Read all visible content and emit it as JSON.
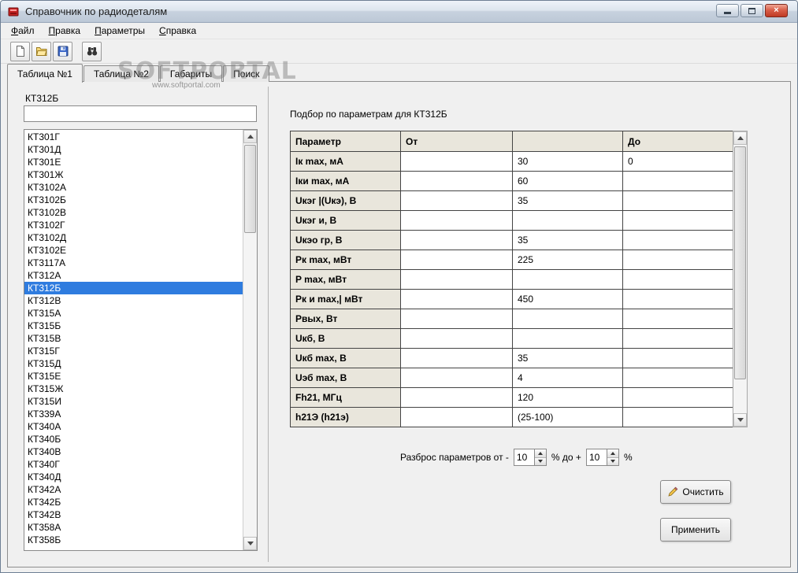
{
  "window": {
    "title": "Справочник по радиодеталям"
  },
  "icons": {
    "app": "red-component",
    "new": "blank-page",
    "open": "open-folder",
    "save": "floppy-disk",
    "find": "binoculars",
    "clear": "pencil",
    "minimize": "minimize-bar",
    "maximize": "restore-square",
    "close": "close-x"
  },
  "menu": {
    "items": [
      {
        "label": "Файл"
      },
      {
        "label": "Правка"
      },
      {
        "label": "Параметры"
      },
      {
        "label": "Справка"
      }
    ]
  },
  "tabs": [
    {
      "label": "Таблица №1",
      "selected": true
    },
    {
      "label": "Таблица №2"
    },
    {
      "label": "Габариты"
    },
    {
      "label": "Поиск"
    }
  ],
  "watermark": {
    "text": "SOFTPORTAL",
    "subtext": "www.softportal.com"
  },
  "left_panel": {
    "label": "КТ312Б",
    "filter_value": "",
    "items": [
      {
        "label": "КТ301Г"
      },
      {
        "label": "КТ301Д"
      },
      {
        "label": "КТ301Е"
      },
      {
        "label": "КТ301Ж"
      },
      {
        "label": "КТ3102А"
      },
      {
        "label": "КТ3102Б"
      },
      {
        "label": "КТ3102В"
      },
      {
        "label": "КТ3102Г"
      },
      {
        "label": "КТ3102Д"
      },
      {
        "label": "КТ3102Е"
      },
      {
        "label": "КТ3117А"
      },
      {
        "label": "КТ312А"
      },
      {
        "label": "КТ312Б",
        "selected": true
      },
      {
        "label": "КТ312В"
      },
      {
        "label": "КТ315А"
      },
      {
        "label": "КТ315Б"
      },
      {
        "label": "КТ315В"
      },
      {
        "label": "КТ315Г"
      },
      {
        "label": "КТ315Д"
      },
      {
        "label": "КТ315Е"
      },
      {
        "label": "КТ315Ж"
      },
      {
        "label": "КТ315И"
      },
      {
        "label": "КТ339А"
      },
      {
        "label": "КТ340А"
      },
      {
        "label": "КТ340Б"
      },
      {
        "label": "КТ340В"
      },
      {
        "label": "КТ340Г"
      },
      {
        "label": "КТ340Д"
      },
      {
        "label": "КТ342А"
      },
      {
        "label": "КТ342Б"
      },
      {
        "label": "КТ342В"
      },
      {
        "label": "КТ358А"
      },
      {
        "label": "КТ358Б"
      }
    ]
  },
  "params_panel": {
    "title": "Подбор по параметрам для КТ312Б",
    "table": {
      "headers": {
        "param": "Параметр",
        "from": "От",
        "value": "",
        "to": "До"
      },
      "rows": [
        {
          "param": "Iк max, мА",
          "from": "",
          "value": "30",
          "to": "0"
        },
        {
          "param": "Iки max, мА",
          "from": "",
          "value": "60",
          "to": ""
        },
        {
          "param": "Uкэг |(Uкэ), В",
          "from": "",
          "value": "35",
          "to": ""
        },
        {
          "param": "Uкэг и, В",
          "from": "",
          "value": "",
          "to": ""
        },
        {
          "param": "Uкэо гр, В",
          "from": "",
          "value": "35",
          "to": ""
        },
        {
          "param": "Pк max, мВт",
          "from": "",
          "value": "225",
          "to": ""
        },
        {
          "param": "P max, мВт",
          "from": "",
          "value": "",
          "to": ""
        },
        {
          "param": "Pк и max,| мВт",
          "from": "",
          "value": "450",
          "to": ""
        },
        {
          "param": "Pвых, Вт",
          "from": "",
          "value": "",
          "to": ""
        },
        {
          "param": "Uкб, В",
          "from": "",
          "value": "",
          "to": ""
        },
        {
          "param": "Uкб max, В",
          "from": "",
          "value": "35",
          "to": ""
        },
        {
          "param": "Uэб max, В",
          "from": "",
          "value": "4",
          "to": ""
        },
        {
          "param": "Fh21, МГц",
          "from": "",
          "value": "120",
          "to": ""
        },
        {
          "param": "h21Э (h21э)",
          "from": "",
          "value": "(25-100)",
          "to": ""
        }
      ]
    },
    "spread": {
      "prefix": "Разброс параметров от -",
      "from_value": "10",
      "mid": "% до +",
      "to_value": "10",
      "suffix": "%"
    },
    "buttons": {
      "clear": "Очистить",
      "apply": "Применить"
    }
  },
  "colors": {
    "selection": "#2F7CDF",
    "close_button": "#BF3A24",
    "table_header_bg": "#E9E6DC"
  }
}
